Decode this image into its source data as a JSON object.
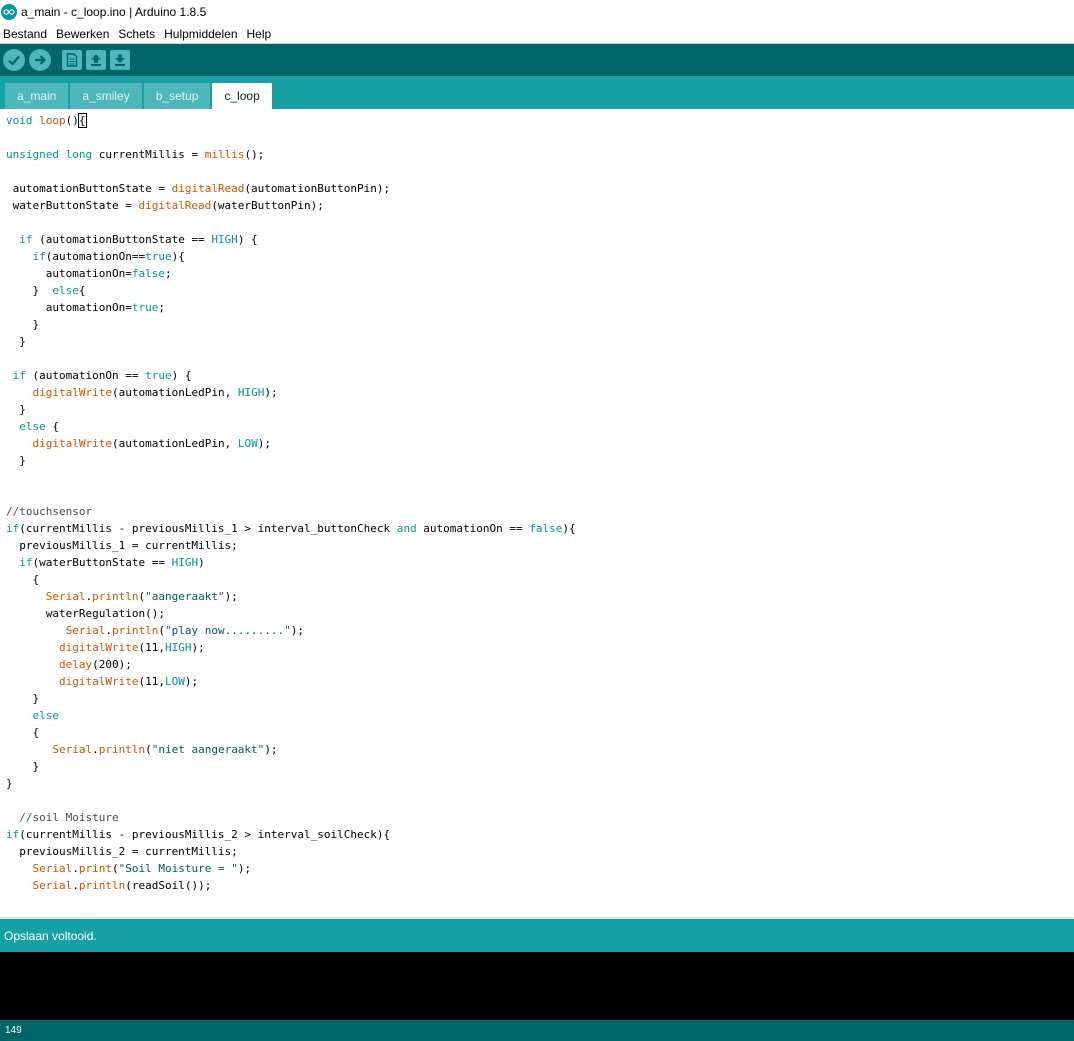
{
  "window": {
    "title": "a_main - c_loop.ino | Arduino 1.8.5"
  },
  "menu": [
    "Bestand",
    "Bewerken",
    "Schets",
    "Hulpmiddelen",
    "Help"
  ],
  "tabs": [
    {
      "label": "a_main",
      "active": false
    },
    {
      "label": "a_smiley",
      "active": false
    },
    {
      "label": "b_setup",
      "active": false
    },
    {
      "label": "c_loop",
      "active": true
    }
  ],
  "code_lines": [
    "void loop(){",
    "",
    "unsigned long currentMillis = millis();",
    "",
    " automationButtonState = digitalRead(automationButtonPin);",
    " waterButtonState = digitalRead(waterButtonPin);",
    "",
    "  if (automationButtonState == HIGH) {",
    "    if(automationOn==true){",
    "      automationOn=false;",
    "    }  else{",
    "      automationOn=true;",
    "    }",
    "  }",
    "",
    " if (automationOn == true) {",
    "    digitalWrite(automationLedPin, HIGH);",
    "  }",
    "  else {",
    "    digitalWrite(automationLedPin, LOW);",
    "  }",
    "",
    "",
    "//touchsensor",
    "if(currentMillis - previousMillis_1 > interval_buttonCheck and automationOn == false){",
    "  previousMillis_1 = currentMillis;",
    "  if(waterButtonState == HIGH)",
    "    {",
    "      Serial.println(\"aangeraakt\");",
    "      waterRegulation();",
    "         Serial.println(\"play now.........\");",
    "        digitalWrite(11,HIGH);",
    "        delay(200);",
    "        digitalWrite(11,LOW);",
    "    }",
    "    else",
    "    {",
    "       Serial.println(\"niet aangeraakt\");",
    "    }",
    "}",
    "",
    "  //soil Moisture",
    "if(currentMillis - previousMillis_2 > interval_soilCheck){",
    "  previousMillis_2 = currentMillis;",
    "    Serial.print(\"Soil Moisture = \");",
    "    Serial.println(readSoil());"
  ],
  "status": {
    "message": "Opslaan voltooid."
  },
  "footer": {
    "line_number": "149"
  },
  "colors": {
    "toolbar": "#006468",
    "tabbar": "#17a1a5",
    "keyword": "#00979c",
    "function": "#d35400",
    "string": "#005c5f"
  },
  "icons": [
    "verify-icon",
    "upload-icon",
    "new-sketch-icon",
    "open-icon",
    "save-icon"
  ]
}
